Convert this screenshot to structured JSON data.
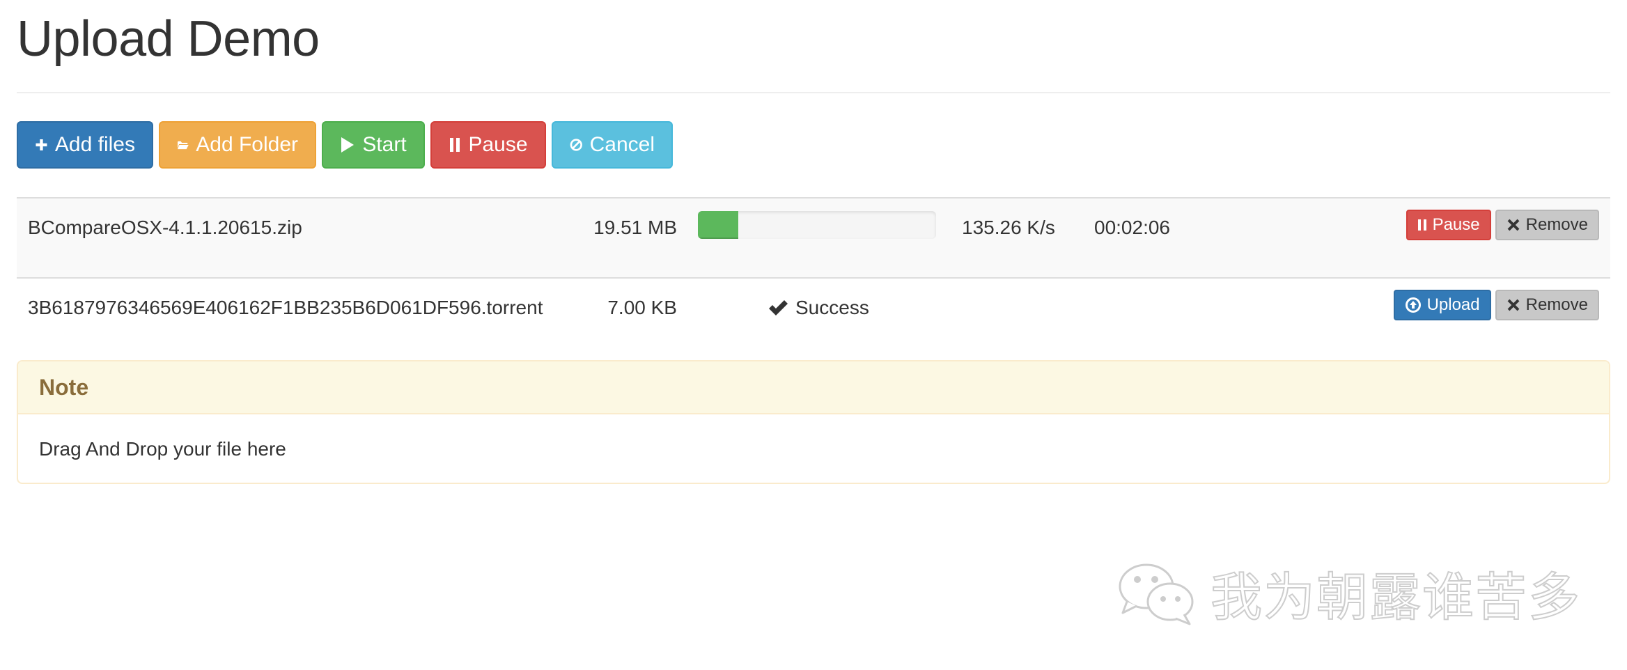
{
  "page": {
    "title": "Upload Demo"
  },
  "toolbar": {
    "add_files": "Add files",
    "add_folder": "Add Folder",
    "start": "Start",
    "pause": "Pause",
    "cancel": "Cancel"
  },
  "files": [
    {
      "name": "BCompareOSX-4.1.1.20615.zip",
      "size": "19.51 MB",
      "progress_fraction": 0.17,
      "speed": "135.26 K/s",
      "time_remaining": "00:02:06",
      "action_label": "Pause",
      "remove_label": "Remove"
    },
    {
      "name": "3B6187976346569E406162F1BB235B6D061DF596.torrent",
      "size": "7.00 KB",
      "status": "Success",
      "action_label": "Upload",
      "remove_label": "Remove"
    }
  ],
  "note": {
    "heading": "Note",
    "body": "Drag And Drop your file here"
  },
  "watermark": {
    "text": "我为朝露谁苦多",
    "icon": "wechat-icon"
  },
  "colors": {
    "primary": "#337ab7",
    "warning": "#f0ad4e",
    "success": "#5cb85c",
    "danger": "#d9534f",
    "info": "#5bc0de",
    "note_text": "#8a6d3b",
    "note_bg": "#fcf8e3"
  },
  "icons": {
    "add_files": "plus-icon",
    "add_folder": "folder-open-icon",
    "start": "play-icon",
    "pause": "pause-icon",
    "cancel": "ban-icon",
    "remove": "times-icon",
    "upload": "circle-arrow-up-icon",
    "success": "check-icon"
  }
}
